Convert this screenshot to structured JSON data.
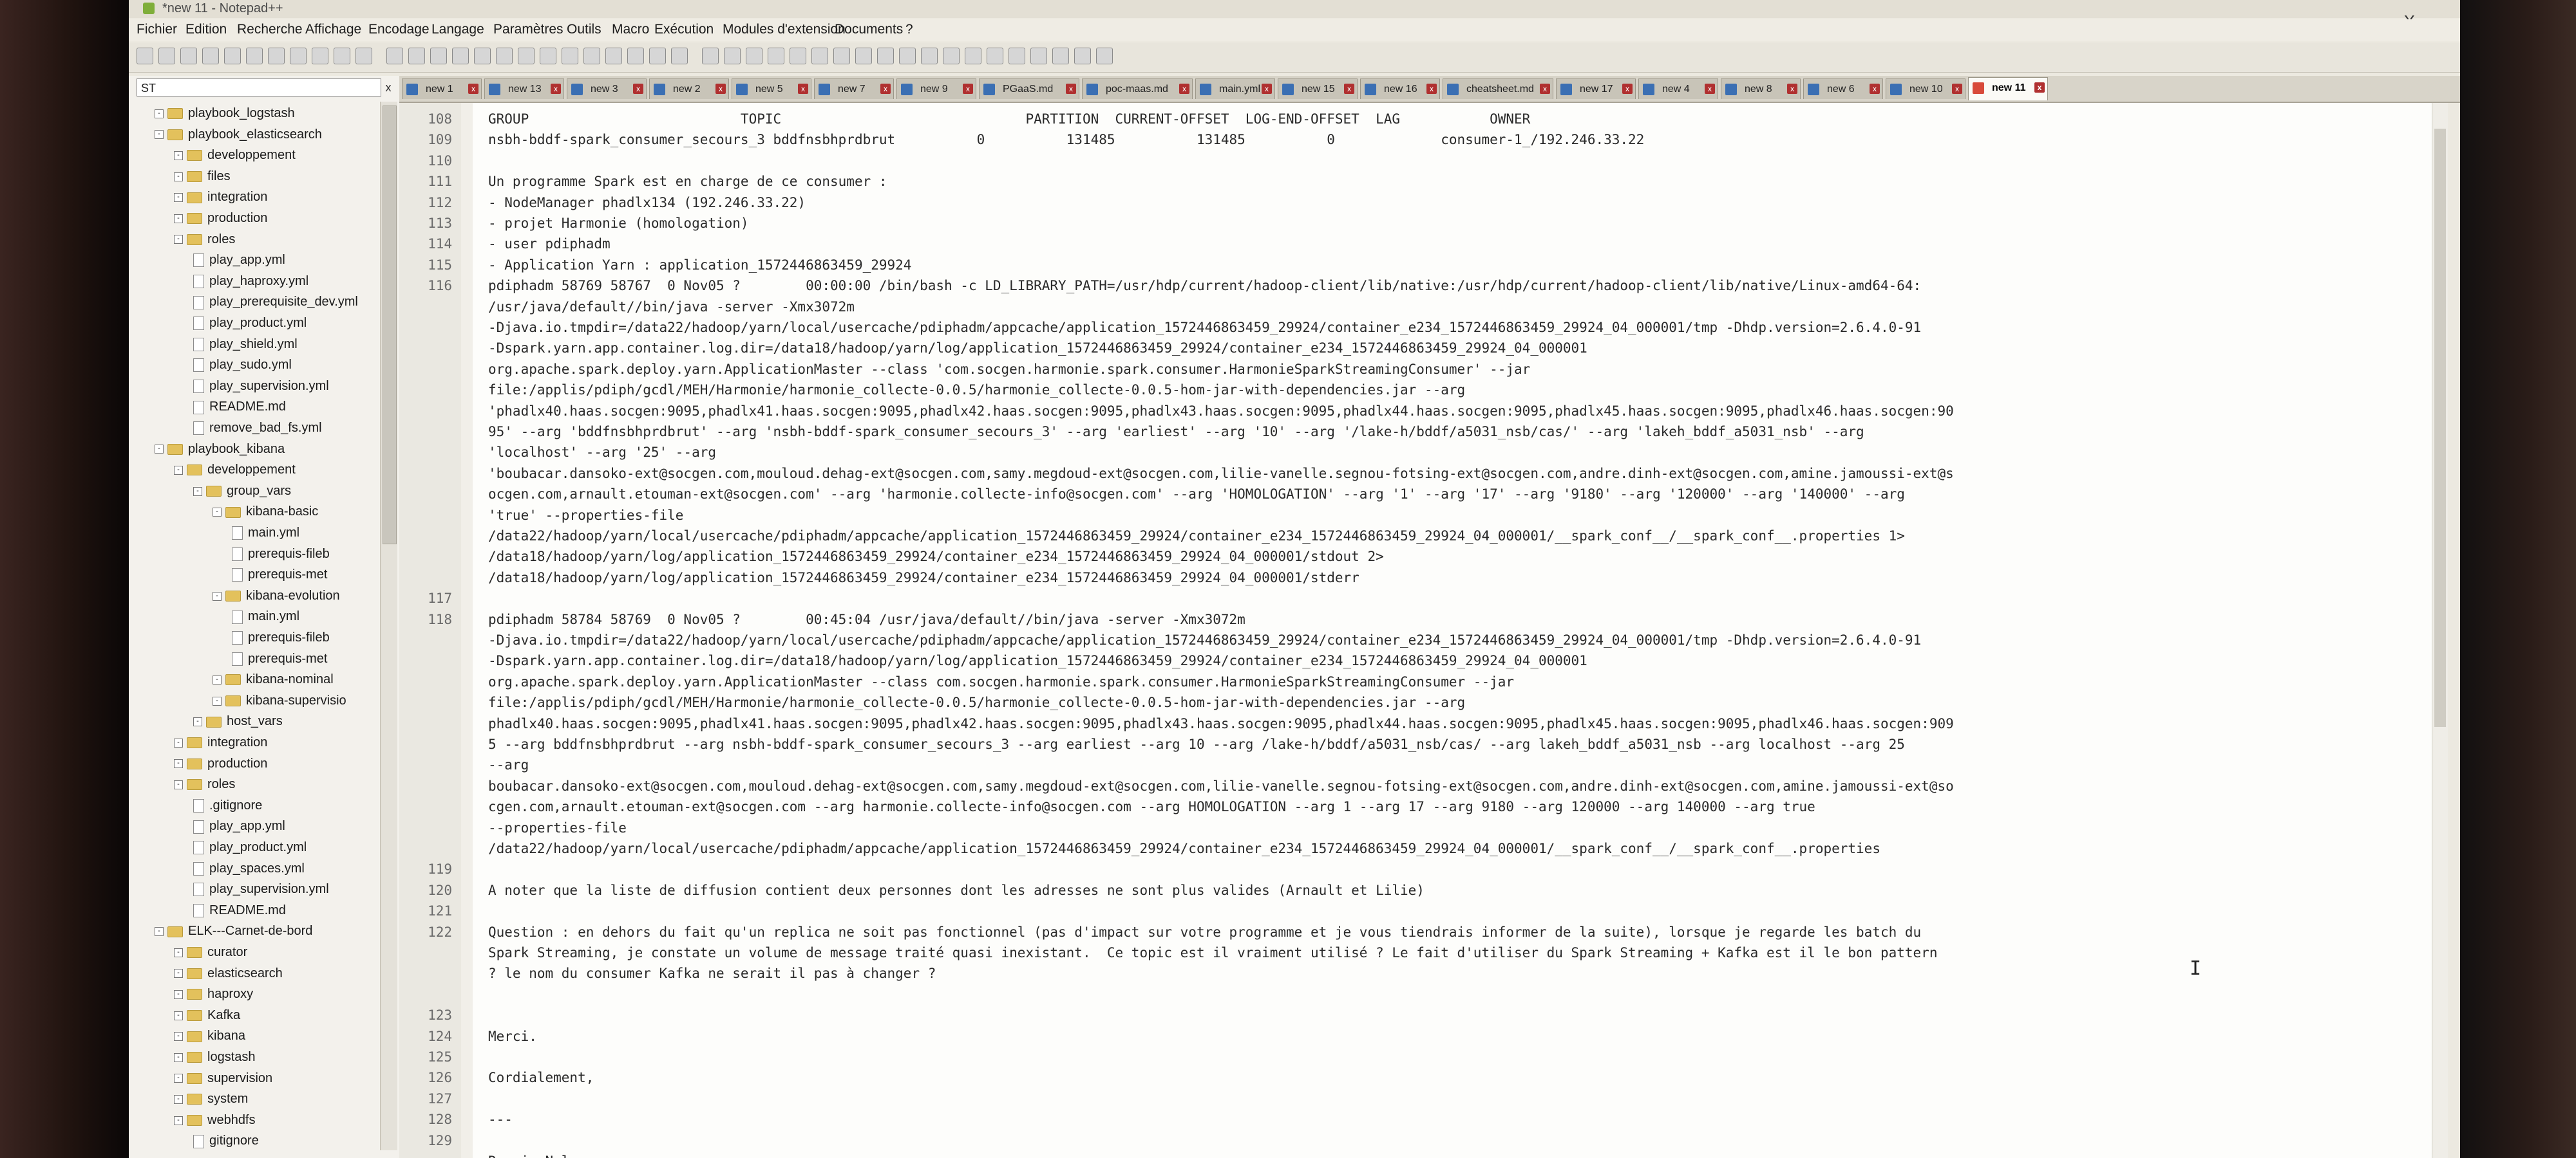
{
  "window": {
    "title": "*new 11 - Notepad++"
  },
  "menu": [
    "Fichier",
    "Edition",
    "Recherche",
    "Affichage",
    "Encodage",
    "Langage",
    "Paramètres",
    "Outils",
    "Macro",
    "Exécution",
    "Modules d'extension",
    "Documents",
    "?"
  ],
  "close_glyph": "X",
  "sidebar": {
    "filter_value": "ST",
    "filter_close": "x",
    "tree": [
      "playbook_logstash",
      "playbook_elasticsearch",
      "developpement",
      "files",
      "integration",
      "production",
      "roles",
      "play_app.yml",
      "play_haproxy.yml",
      "play_prerequisite_dev.yml",
      "play_product.yml",
      "play_shield.yml",
      "play_sudo.yml",
      "play_supervision.yml",
      "README.md",
      "remove_bad_fs.yml",
      "playbook_kibana",
      "developpement",
      "group_vars",
      "kibana-basic",
      "main.yml",
      "prerequis-fileb",
      "prerequis-met",
      "kibana-evolution",
      "main.yml",
      "prerequis-fileb",
      "prerequis-met",
      "kibana-nominal",
      "kibana-supervisio",
      "host_vars",
      "integration",
      "production",
      "roles",
      ".gitignore",
      "play_app.yml",
      "play_product.yml",
      "play_spaces.yml",
      "play_supervision.yml",
      "README.md",
      "ELK---Carnet-de-bord",
      "curator",
      "elasticsearch",
      "haproxy",
      "Kafka",
      "kibana",
      "logstash",
      "supervision",
      "system",
      "webhdfs",
      "gitignore"
    ]
  },
  "tabs": [
    "new 1",
    "new 13",
    "new 3",
    "new 2",
    "new 5",
    "new 7",
    "new 9",
    "PGaaS.md",
    "poc-maas.md",
    "main.yml",
    "new 15",
    "new 16",
    "cheatsheet.md",
    "new 17",
    "new 4",
    "new 8",
    "new 6",
    "new 10",
    "new 11"
  ],
  "tab_close_glyph": "x",
  "editor": {
    "lines": [
      {
        "n": "108",
        "t": "GROUP                          TOPIC                              PARTITION  CURRENT-OFFSET  LOG-END-OFFSET  LAG           OWNER"
      },
      {
        "n": "109",
        "t": "nsbh-bddf-spark_consumer_secours_3 bddfnsbhprdbrut          0          131485          131485          0             consumer-1_/192.246.33.22"
      },
      {
        "n": "110",
        "t": ""
      },
      {
        "n": "111",
        "t": "Un programme Spark est en charge de ce consumer :"
      },
      {
        "n": "112",
        "t": "- NodeManager phadlx134 (192.246.33.22)"
      },
      {
        "n": "113",
        "t": "- projet Harmonie (homologation)"
      },
      {
        "n": "114",
        "t": "- user pdiphadm"
      },
      {
        "n": "115",
        "t": "- Application Yarn : application_1572446863459_29924"
      },
      {
        "n": "116",
        "t": "pdiphadm 58769 58767  0 Nov05 ?        00:00:00 /bin/bash -c LD_LIBRARY_PATH=/usr/hdp/current/hadoop-client/lib/native:/usr/hdp/current/hadoop-client/lib/native/Linux-amd64-64:"
      },
      {
        "n": "",
        "t": "/usr/java/default//bin/java -server -Xmx3072m"
      },
      {
        "n": "",
        "t": "-Djava.io.tmpdir=/data22/hadoop/yarn/local/usercache/pdiphadm/appcache/application_1572446863459_29924/container_e234_1572446863459_29924_04_000001/tmp -Dhdp.version=2.6.4.0-91"
      },
      {
        "n": "",
        "t": "-Dspark.yarn.app.container.log.dir=/data18/hadoop/yarn/log/application_1572446863459_29924/container_e234_1572446863459_29924_04_000001"
      },
      {
        "n": "",
        "t": "org.apache.spark.deploy.yarn.ApplicationMaster --class 'com.socgen.harmonie.spark.consumer.HarmonieSparkStreamingConsumer' --jar"
      },
      {
        "n": "",
        "t": "file:/applis/pdiph/gcdl/MEH/Harmonie/harmonie_collecte-0.0.5/harmonie_collecte-0.0.5-hom-jar-with-dependencies.jar --arg"
      },
      {
        "n": "",
        "t": "'phadlx40.haas.socgen:9095,phadlx41.haas.socgen:9095,phadlx42.haas.socgen:9095,phadlx43.haas.socgen:9095,phadlx44.haas.socgen:9095,phadlx45.haas.socgen:9095,phadlx46.haas.socgen:90"
      },
      {
        "n": "",
        "t": "95' --arg 'bddfnsbhprdbrut' --arg 'nsbh-bddf-spark_consumer_secours_3' --arg 'earliest' --arg '10' --arg '/lake-h/bddf/a5031_nsb/cas/' --arg 'lakeh_bddf_a5031_nsb' --arg"
      },
      {
        "n": "",
        "t": "'localhost' --arg '25' --arg"
      },
      {
        "n": "",
        "t": "'boubacar.dansoko-ext@socgen.com,mouloud.dehag-ext@socgen.com,samy.megdoud-ext@socgen.com,lilie-vanelle.segnou-fotsing-ext@socgen.com,andre.dinh-ext@socgen.com,amine.jamoussi-ext@s"
      },
      {
        "n": "",
        "t": "ocgen.com,arnault.etouman-ext@socgen.com' --arg 'harmonie.collecte-info@socgen.com' --arg 'HOMOLOGATION' --arg '1' --arg '17' --arg '9180' --arg '120000' --arg '140000' --arg"
      },
      {
        "n": "",
        "t": "'true' --properties-file"
      },
      {
        "n": "",
        "t": "/data22/hadoop/yarn/local/usercache/pdiphadm/appcache/application_1572446863459_29924/container_e234_1572446863459_29924_04_000001/__spark_conf__/__spark_conf__.properties 1>"
      },
      {
        "n": "",
        "t": "/data18/hadoop/yarn/log/application_1572446863459_29924/container_e234_1572446863459_29924_04_000001/stdout 2>"
      },
      {
        "n": "",
        "t": "/data18/hadoop/yarn/log/application_1572446863459_29924/container_e234_1572446863459_29924_04_000001/stderr"
      },
      {
        "n": "117",
        "t": ""
      },
      {
        "n": "118",
        "t": "pdiphadm 58784 58769  0 Nov05 ?        00:45:04 /usr/java/default//bin/java -server -Xmx3072m"
      },
      {
        "n": "",
        "t": "-Djava.io.tmpdir=/data22/hadoop/yarn/local/usercache/pdiphadm/appcache/application_1572446863459_29924/container_e234_1572446863459_29924_04_000001/tmp -Dhdp.version=2.6.4.0-91"
      },
      {
        "n": "",
        "t": "-Dspark.yarn.app.container.log.dir=/data18/hadoop/yarn/log/application_1572446863459_29924/container_e234_1572446863459_29924_04_000001"
      },
      {
        "n": "",
        "t": "org.apache.spark.deploy.yarn.ApplicationMaster --class com.socgen.harmonie.spark.consumer.HarmonieSparkStreamingConsumer --jar"
      },
      {
        "n": "",
        "t": "file:/applis/pdiph/gcdl/MEH/Harmonie/harmonie_collecte-0.0.5/harmonie_collecte-0.0.5-hom-jar-with-dependencies.jar --arg"
      },
      {
        "n": "",
        "t": "phadlx40.haas.socgen:9095,phadlx41.haas.socgen:9095,phadlx42.haas.socgen:9095,phadlx43.haas.socgen:9095,phadlx44.haas.socgen:9095,phadlx45.haas.socgen:9095,phadlx46.haas.socgen:909"
      },
      {
        "n": "",
        "t": "5 --arg bddfnsbhprdbrut --arg nsbh-bddf-spark_consumer_secours_3 --arg earliest --arg 10 --arg /lake-h/bddf/a5031_nsb/cas/ --arg lakeh_bddf_a5031_nsb --arg localhost --arg 25"
      },
      {
        "n": "",
        "t": "--arg"
      },
      {
        "n": "",
        "t": "boubacar.dansoko-ext@socgen.com,mouloud.dehag-ext@socgen.com,samy.megdoud-ext@socgen.com,lilie-vanelle.segnou-fotsing-ext@socgen.com,andre.dinh-ext@socgen.com,amine.jamoussi-ext@so"
      },
      {
        "n": "",
        "t": "cgen.com,arnault.etouman-ext@socgen.com --arg harmonie.collecte-info@socgen.com --arg HOMOLOGATION --arg 1 --arg 17 --arg 9180 --arg 120000 --arg 140000 --arg true"
      },
      {
        "n": "",
        "t": "--properties-file"
      },
      {
        "n": "",
        "t": "/data22/hadoop/yarn/local/usercache/pdiphadm/appcache/application_1572446863459_29924/container_e234_1572446863459_29924_04_000001/__spark_conf__/__spark_conf__.properties"
      },
      {
        "n": "119",
        "t": ""
      },
      {
        "n": "120",
        "t": "A noter que la liste de diffusion contient deux personnes dont les adresses ne sont plus valides (Arnault et Lilie)"
      },
      {
        "n": "121",
        "t": ""
      },
      {
        "n": "122",
        "t": "Question : en dehors du fait qu'un replica ne soit pas fonctionnel (pas d'impact sur votre programme et je vous tiendrais informer de la suite), lorsque je regarde les batch du"
      },
      {
        "n": "",
        "t": "Spark Streaming, je constate un volume de message traité quasi inexistant.  Ce topic est il vraiment utilisé ? Le fait d'utiliser du Spark Streaming + Kafka est il le bon pattern"
      },
      {
        "n": "",
        "t": "? le nom du consumer Kafka ne serait il pas à changer ?"
      },
      {
        "n": "",
        "t": ""
      },
      {
        "n": "123",
        "t": ""
      },
      {
        "n": "124",
        "t": "Merci."
      },
      {
        "n": "125",
        "t": ""
      },
      {
        "n": "126",
        "t": "Cordialement,"
      },
      {
        "n": "127",
        "t": ""
      },
      {
        "n": "128",
        "t": "---"
      },
      {
        "n": "129",
        "t": ""
      },
      {
        "n": "",
        "t": "Romain Nalaze"
      }
    ]
  }
}
